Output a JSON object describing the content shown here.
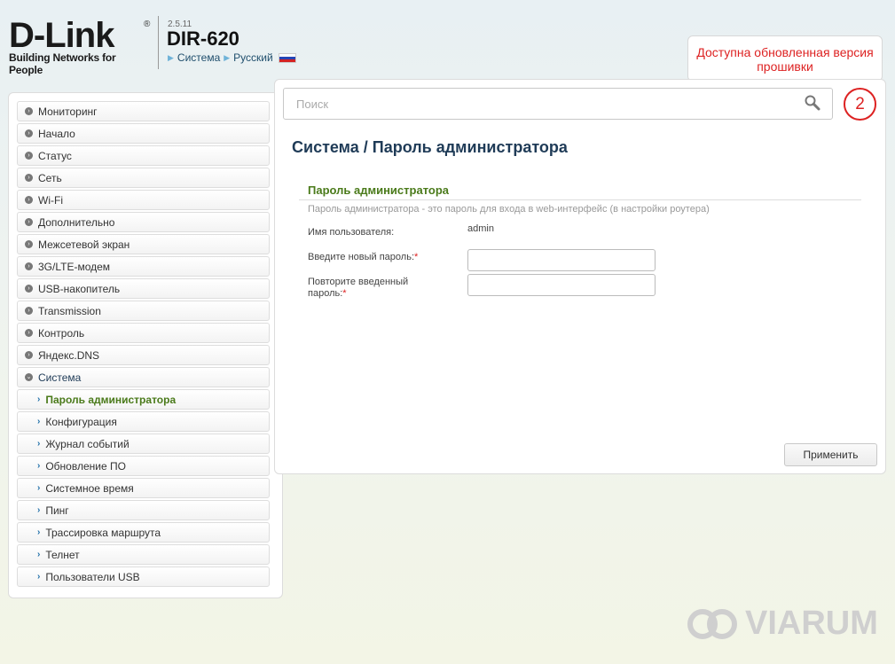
{
  "header": {
    "logo_text": "D-Link",
    "logo_tagline": "Building Networks for People",
    "firmware_version": "2.5.11",
    "model": "DIR-620",
    "breadcrumb": [
      "Система",
      "Русский"
    ]
  },
  "notification": {
    "text": "Доступна обновленная версия прошивки",
    "count": "2"
  },
  "search": {
    "placeholder": "Поиск"
  },
  "sidebar": {
    "items": [
      {
        "label": "Мониторинг"
      },
      {
        "label": "Начало"
      },
      {
        "label": "Статус"
      },
      {
        "label": "Сеть"
      },
      {
        "label": "Wi-Fi"
      },
      {
        "label": "Дополнительно"
      },
      {
        "label": "Межсетевой экран"
      },
      {
        "label": "3G/LTE-модем"
      },
      {
        "label": "USB-накопитель"
      },
      {
        "label": "Transmission"
      },
      {
        "label": "Контроль"
      },
      {
        "label": "Яндекс.DNS"
      },
      {
        "label": "Система"
      }
    ],
    "subitems": [
      {
        "label": "Пароль администратора"
      },
      {
        "label": "Конфигурация"
      },
      {
        "label": "Журнал событий"
      },
      {
        "label": "Обновление ПО"
      },
      {
        "label": "Системное время"
      },
      {
        "label": "Пинг"
      },
      {
        "label": "Трассировка маршрута"
      },
      {
        "label": "Телнет"
      },
      {
        "label": "Пользователи USB"
      }
    ]
  },
  "main": {
    "title": "Система /  Пароль администратора",
    "section_title": "Пароль администратора",
    "section_desc": "Пароль администратора - это пароль для входа в web-интерфейс (в настройки роутера)",
    "username_label": "Имя пользователя:",
    "username_value": "admin",
    "new_password_label": "Введите новый пароль:",
    "repeat_password_label": "Повторите введенный пароль:",
    "required_mark": "*",
    "new_password_value": "",
    "repeat_password_value": "",
    "apply_label": "Применить"
  },
  "watermark": "VIARUM"
}
